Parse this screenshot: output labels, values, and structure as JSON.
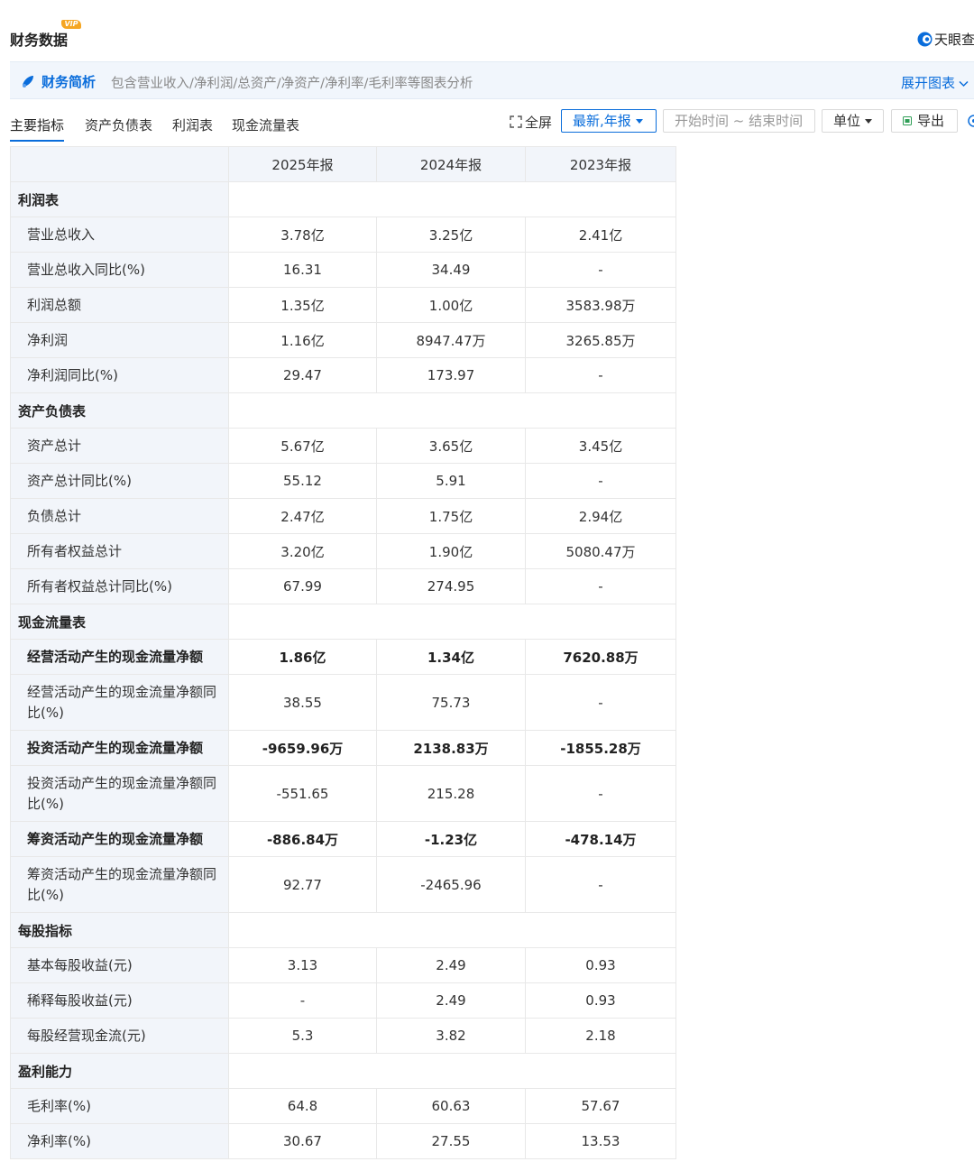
{
  "header": {
    "title": "财务数据",
    "vip": "VIP",
    "brand": "天眼查"
  },
  "banner": {
    "title": "财务简析",
    "description": "包含营业收入/净利润/总资产/净资产/净利率/毛利率等图表分析",
    "expand_label": "展开图表"
  },
  "tabs": [
    "主要指标",
    "资产负债表",
    "利润表",
    "现金流量表"
  ],
  "toolbar": {
    "fullscreen_label": "全屏",
    "period_label": "最新,年报",
    "date_placeholder": "开始时间 ~ 结束时间",
    "unit_label": "单位",
    "export_label": "导出"
  },
  "table": {
    "columns": [
      "2025年报",
      "2024年报",
      "2023年报"
    ],
    "sections": [
      {
        "title": "利润表",
        "rows": [
          {
            "label": "营业总收入",
            "values": [
              "3.78亿",
              "3.25亿",
              "2.41亿"
            ]
          },
          {
            "label": "营业总收入同比(%)",
            "values": [
              "16.31",
              "34.49",
              "-"
            ]
          },
          {
            "label": "利润总额",
            "values": [
              "1.35亿",
              "1.00亿",
              "3583.98万"
            ]
          },
          {
            "label": "净利润",
            "values": [
              "1.16亿",
              "8947.47万",
              "3265.85万"
            ]
          },
          {
            "label": "净利润同比(%)",
            "values": [
              "29.47",
              "173.97",
              "-"
            ]
          }
        ]
      },
      {
        "title": "资产负债表",
        "rows": [
          {
            "label": "资产总计",
            "values": [
              "5.67亿",
              "3.65亿",
              "3.45亿"
            ]
          },
          {
            "label": "资产总计同比(%)",
            "values": [
              "55.12",
              "5.91",
              "-"
            ]
          },
          {
            "label": "负债总计",
            "values": [
              "2.47亿",
              "1.75亿",
              "2.94亿"
            ]
          },
          {
            "label": "所有者权益总计",
            "values": [
              "3.20亿",
              "1.90亿",
              "5080.47万"
            ]
          },
          {
            "label": "所有者权益总计同比(%)",
            "values": [
              "67.99",
              "274.95",
              "-"
            ]
          }
        ]
      },
      {
        "title": "现金流量表",
        "rows": [
          {
            "label": "经营活动产生的现金流量净额",
            "values": [
              "1.86亿",
              "1.34亿",
              "7620.88万"
            ],
            "bold": true
          },
          {
            "label": "经营活动产生的现金流量净额同比(%)",
            "values": [
              "38.55",
              "75.73",
              "-"
            ],
            "tall": true
          },
          {
            "label": "投资活动产生的现金流量净额",
            "values": [
              "-9659.96万",
              "2138.83万",
              "-1855.28万"
            ],
            "bold": true
          },
          {
            "label": "投资活动产生的现金流量净额同比(%)",
            "values": [
              "-551.65",
              "215.28",
              "-"
            ],
            "tall": true
          },
          {
            "label": "筹资活动产生的现金流量净额",
            "values": [
              "-886.84万",
              "-1.23亿",
              "-478.14万"
            ],
            "bold": true
          },
          {
            "label": "筹资活动产生的现金流量净额同比(%)",
            "values": [
              "92.77",
              "-2465.96",
              "-"
            ],
            "tall": true
          }
        ]
      },
      {
        "title": "每股指标",
        "rows": [
          {
            "label": "基本每股收益(元)",
            "values": [
              "3.13",
              "2.49",
              "0.93"
            ]
          },
          {
            "label": "稀释每股收益(元)",
            "values": [
              "-",
              "2.49",
              "0.93"
            ]
          },
          {
            "label": "每股经营现金流(元)",
            "values": [
              "5.3",
              "3.82",
              "2.18"
            ]
          }
        ]
      },
      {
        "title": "盈利能力",
        "rows": [
          {
            "label": "毛利率(%)",
            "values": [
              "64.8",
              "60.63",
              "57.67"
            ]
          },
          {
            "label": "净利率(%)",
            "values": [
              "30.67",
              "27.55",
              "13.53"
            ]
          }
        ]
      }
    ]
  },
  "colors": {
    "accent": "#0a6ddb",
    "header_bg": "#f2f5fa",
    "banner_bg": "#f1f6fc",
    "vip": "#f5a623"
  }
}
